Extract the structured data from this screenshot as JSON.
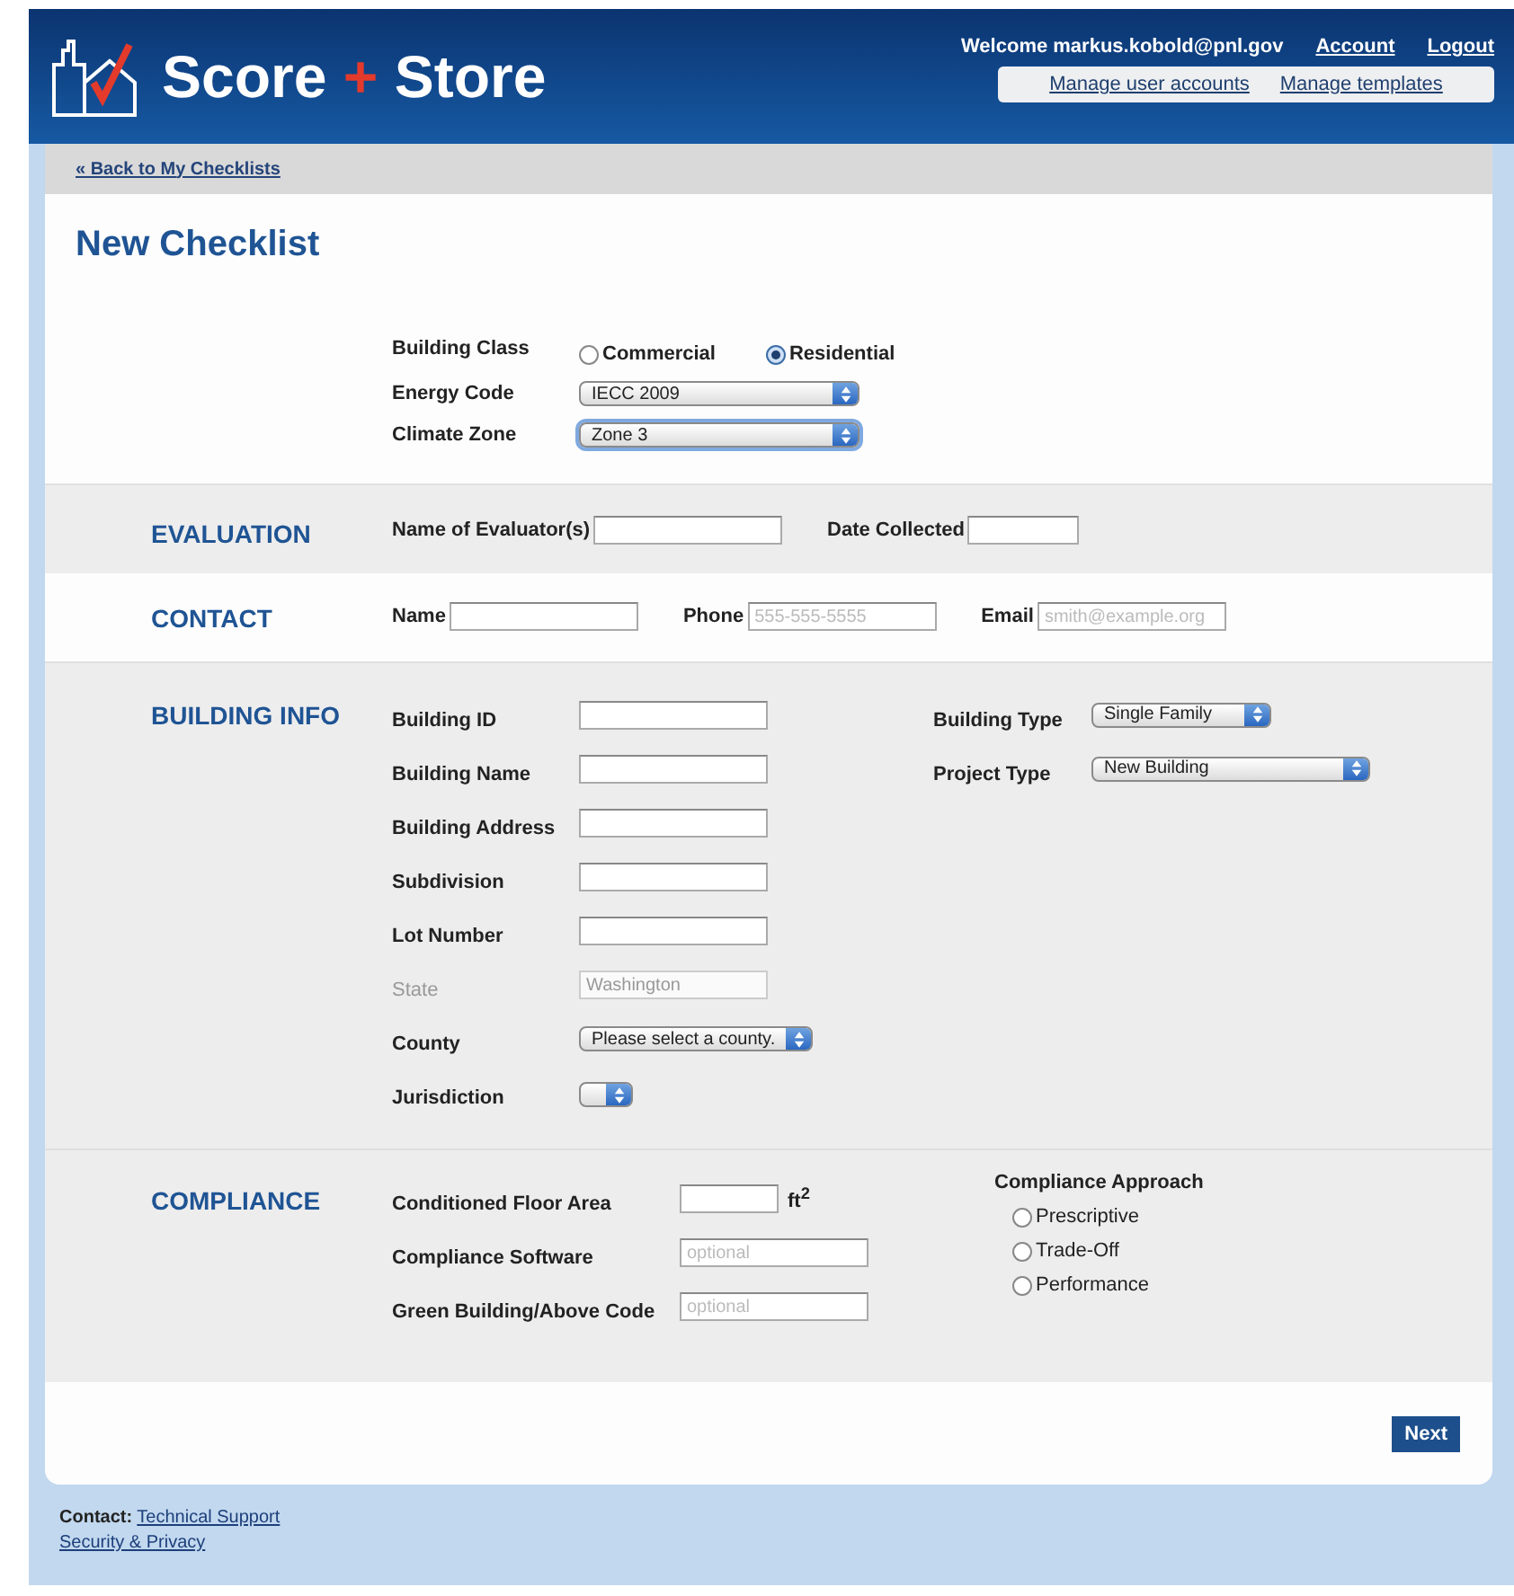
{
  "header": {
    "logo": {
      "word1": "Score",
      "plus": "+",
      "word2": "Store"
    },
    "welcome": "Welcome markus.kobold@pnl.gov",
    "user_links": [
      "Account",
      "Logout"
    ],
    "admin_links": [
      "Manage user accounts",
      "Manage templates"
    ]
  },
  "back_link": "« Back to My Checklists",
  "title": "New Checklist",
  "building_class": {
    "label": "Building Class",
    "options": [
      {
        "label": "Commercial",
        "selected": false
      },
      {
        "label": "Residential",
        "selected": true
      }
    ]
  },
  "energy_code": {
    "label": "Energy Code",
    "value": "IECC 2009",
    "focused": false
  },
  "climate_zone": {
    "label": "Climate Zone",
    "value": "Zone 3",
    "focused": true
  },
  "sections": [
    {
      "heading": "EVALUATION",
      "kind": "inline",
      "shaded": true,
      "fields": [
        {
          "kind": "text",
          "label": "Name of Evaluator(s)"
        },
        {
          "kind": "text",
          "label": "Date Collected"
        }
      ]
    },
    {
      "heading": "CONTACT",
      "kind": "inline",
      "shaded": false,
      "fields": [
        {
          "kind": "text",
          "label": "Name"
        },
        {
          "kind": "text",
          "label": "Phone",
          "placeholder": "555-555-5555"
        },
        {
          "kind": "text",
          "label": "Email",
          "placeholder": "smith@example.org"
        }
      ]
    },
    {
      "heading": "BUILDING INFO",
      "kind": "columns",
      "shaded": true,
      "columns": [
        [
          {
            "kind": "text",
            "label": "Building ID",
            "disabled": false
          },
          {
            "kind": "text",
            "label": "Building Name",
            "disabled": false
          },
          {
            "kind": "text",
            "label": "Building Address",
            "disabled": false
          },
          {
            "kind": "text",
            "label": "Subdivision",
            "disabled": false
          },
          {
            "kind": "text",
            "label": "Lot Number",
            "disabled": false
          },
          {
            "kind": "text",
            "label": "State",
            "value": "Washington",
            "disabled": true
          },
          {
            "kind": "select",
            "label": "County",
            "value": "Please select a county.",
            "disabled": false
          },
          {
            "kind": "select",
            "label": "Jurisdiction",
            "disabled": false
          }
        ],
        [
          {
            "kind": "select",
            "label": "Building Type",
            "value": "Single Family"
          },
          {
            "kind": "select",
            "label": "Project Type",
            "value": "New Building"
          }
        ]
      ]
    },
    {
      "heading": "COMPLIANCE",
      "kind": "columns",
      "shaded": true,
      "columns": [
        [
          {
            "kind": "text",
            "label": "Conditioned Floor Area",
            "unit": "ft$^{2}$"
          },
          {
            "kind": "text",
            "label": "Compliance Software",
            "placeholder": "optional"
          },
          {
            "kind": "text",
            "label": "Green Building/Above Code",
            "placeholder": "optional"
          }
        ],
        [
          {
            "kind": "radio-group",
            "title": "Compliance Approach",
            "options": [
              {
                "label": "Prescriptive",
                "selected": false
              },
              {
                "label": "Trade-Off",
                "selected": false
              },
              {
                "label": "Performance",
                "selected": false
              }
            ]
          }
        ]
      ]
    }
  ],
  "next_button": "Next",
  "footer": {
    "contact_label": "Contact:",
    "contact_link": "Technical Support",
    "privacy_link": "Security & Privacy"
  }
}
